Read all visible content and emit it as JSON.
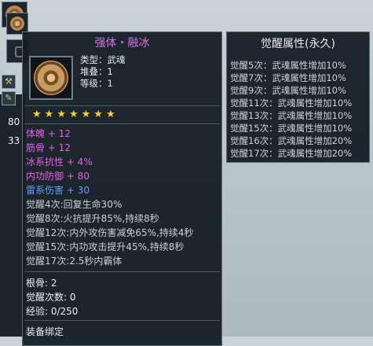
{
  "background": {
    "numbers": [
      "80",
      "33"
    ]
  },
  "tooltip": {
    "title": "强体・融冰",
    "info": [
      "类型：武魂",
      "堆叠：1",
      "等级：1"
    ],
    "stars": [
      "★",
      "★",
      "★",
      "★",
      "★",
      "★",
      "★"
    ],
    "stat_lines": [
      {
        "text": "体魄 + 12",
        "color": "magenta"
      },
      {
        "text": "筋骨 + 12",
        "color": "magenta"
      },
      {
        "text": "冰系抗性 + 4%",
        "color": "magenta"
      },
      {
        "text": "内功防御 + 80",
        "color": "magenta"
      },
      {
        "text": "雷系伤害 + 30",
        "color": "blue"
      }
    ],
    "awaken_effects": [
      "觉醒4次:回复生命30%",
      "觉醒8次:火抗提升85%,持续8秒",
      "觉醒12次:内外攻伤害减免65%,持续4秒",
      "觉醒15次:内功攻击提升45%,持续8秒",
      "觉醒17次:2.5秒内霸体"
    ],
    "footer_stats": [
      "根骨: 2",
      "觉醒次数: 0",
      "经验: 0/250"
    ],
    "bind": "装备绑定"
  },
  "awaken_panel": {
    "title": "觉醒属性(永久)",
    "lines": [
      "觉醒5次：武魂属性增加10%",
      "觉醒7次：武魂属性增加10%",
      "觉醒9次：武魂属性增加10%",
      "觉醒11次：武魂属性增加10%",
      "觉醒13次：武魂属性增加10%",
      "觉醒15次：武魂属性增加10%",
      "觉醒16次：武魂属性增加20%",
      "觉醒17次：武魂属性增加20%"
    ]
  }
}
